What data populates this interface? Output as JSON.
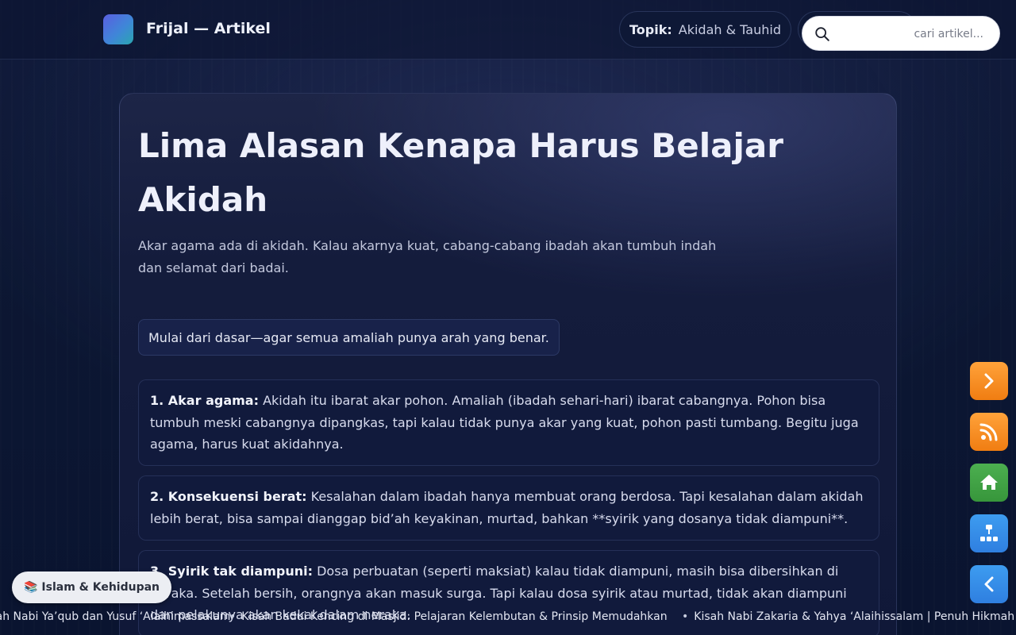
{
  "header": {
    "brand": "Frijal — Artikel",
    "topic_key": "Topik:",
    "topic_value": "Akidah & Tauhid",
    "search_placeholder": "cari artikel..."
  },
  "article": {
    "title": "Lima Alasan Kenapa Harus Belajar Akidah",
    "subtitle": "Akar agama ada di akidah. Kalau akarnya kuat, cabang-cabang ibadah akan tumbuh indah dan selamat dari badai.",
    "callout": "Mulai dari dasar—agar semua amaliah punya arah yang benar.",
    "reasons": [
      {
        "heading": "1. Akar agama:",
        "text": "Akidah itu ibarat akar pohon. Amaliah (ibadah sehari-hari) ibarat cabangnya. Pohon bisa tumbuh meski cabangnya dipangkas, tapi kalau tidak punya akar yang kuat, pohon pasti tumbang. Begitu juga agama, harus kuat akidahnya."
      },
      {
        "heading": "2. Konsekuensi berat:",
        "text": "Kesalahan dalam ibadah hanya membuat orang berdosa. Tapi kesalahan dalam akidah lebih berat, bisa sampai dianggap bid’ah keyakinan, murtad, bahkan **syirik yang dosanya tidak diampuni**."
      },
      {
        "heading": "3. Syirik tak diampuni:",
        "text": "Dosa perbuatan (seperti maksiat) kalau tidak diampuni, masih bisa dibersihkan di neraka. Setelah bersih, orangnya akan masuk surga. Tapi kalau dosa syirik atau murtad, tidak akan diampuni dan pelakunya akan kekal dalam neraka."
      }
    ]
  },
  "floating_buttons": {
    "next": "chevron-right-icon",
    "rss": "rss-icon",
    "home": "home-icon",
    "sitemap": "sitemap-icon",
    "prev": "chevron-left-icon"
  },
  "category_chip": {
    "emoji": "📚",
    "label": "Islam & Kehidupan"
  },
  "ticker": {
    "items": [
      "Kisah Nabi Ya’qub dan Yusuf ‘Alaihimassalam",
      "Kisah Badui Kencing di Masjid: Pelajaran Kelembutan & Prinsip Memudahkan",
      "Kisah Nabi Zakaria & Yahya ‘Alaihissalam | Penuh Hikmah"
    ]
  },
  "colors": {
    "background": "#0c1733",
    "orange": "#f7901e",
    "green": "#43a547",
    "blue": "#358ce8"
  }
}
